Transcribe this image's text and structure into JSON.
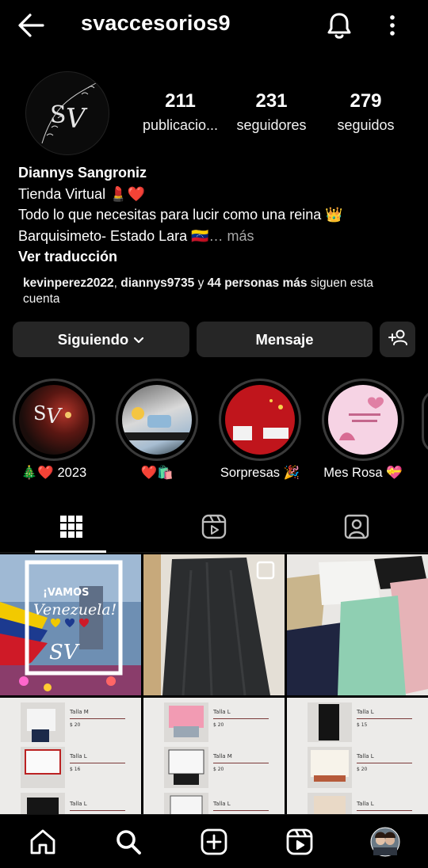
{
  "header": {
    "username": "svaccesorios9"
  },
  "stats": [
    {
      "value": "211",
      "label": "publicacio..."
    },
    {
      "value": "231",
      "label": "seguidores"
    },
    {
      "value": "279",
      "label": "seguidos"
    }
  ],
  "bio": {
    "name": "Diannys Sangroniz",
    "line1": "Tienda Virtual 💄❤️",
    "line2": "Todo lo que necesitas para lucir como una reina 👑",
    "line3": "Barquisimeto- Estado Lara 🇻🇪",
    "more": "… más",
    "translate": "Ver traducción"
  },
  "followed_by": {
    "user1": "kevinperez2022",
    "user2": "diannys9735",
    "connector": " y ",
    "others": "44 personas más",
    "suffix": " siguen esta cuenta"
  },
  "buttons": {
    "following": "Siguiendo",
    "message": "Mensaje"
  },
  "highlights": [
    {
      "label": "🎄❤️ 2023"
    },
    {
      "label": "❤️🛍️"
    },
    {
      "label": "Sorpresas 🎉"
    },
    {
      "label": "Mes Rosa 💝"
    }
  ],
  "posts": {
    "vamos_line1": "¡VAMOS",
    "vamos_line2": "Venezuela!",
    "monogram": "SV",
    "talla_m": "Talla M",
    "talla_l": "Talla L",
    "price_20": "$ 20",
    "price_16": "$ 16",
    "price_15": "$ 15"
  },
  "icons": {
    "back": "arrow-left-icon",
    "bell": "bell-icon",
    "kebab": "more-vertical-icon",
    "grid": "grid-icon",
    "reels": "reels-icon",
    "tagged": "tagged-icon",
    "home": "home-icon",
    "search": "search-icon",
    "create": "create-icon",
    "profile": "profile-avatar"
  }
}
